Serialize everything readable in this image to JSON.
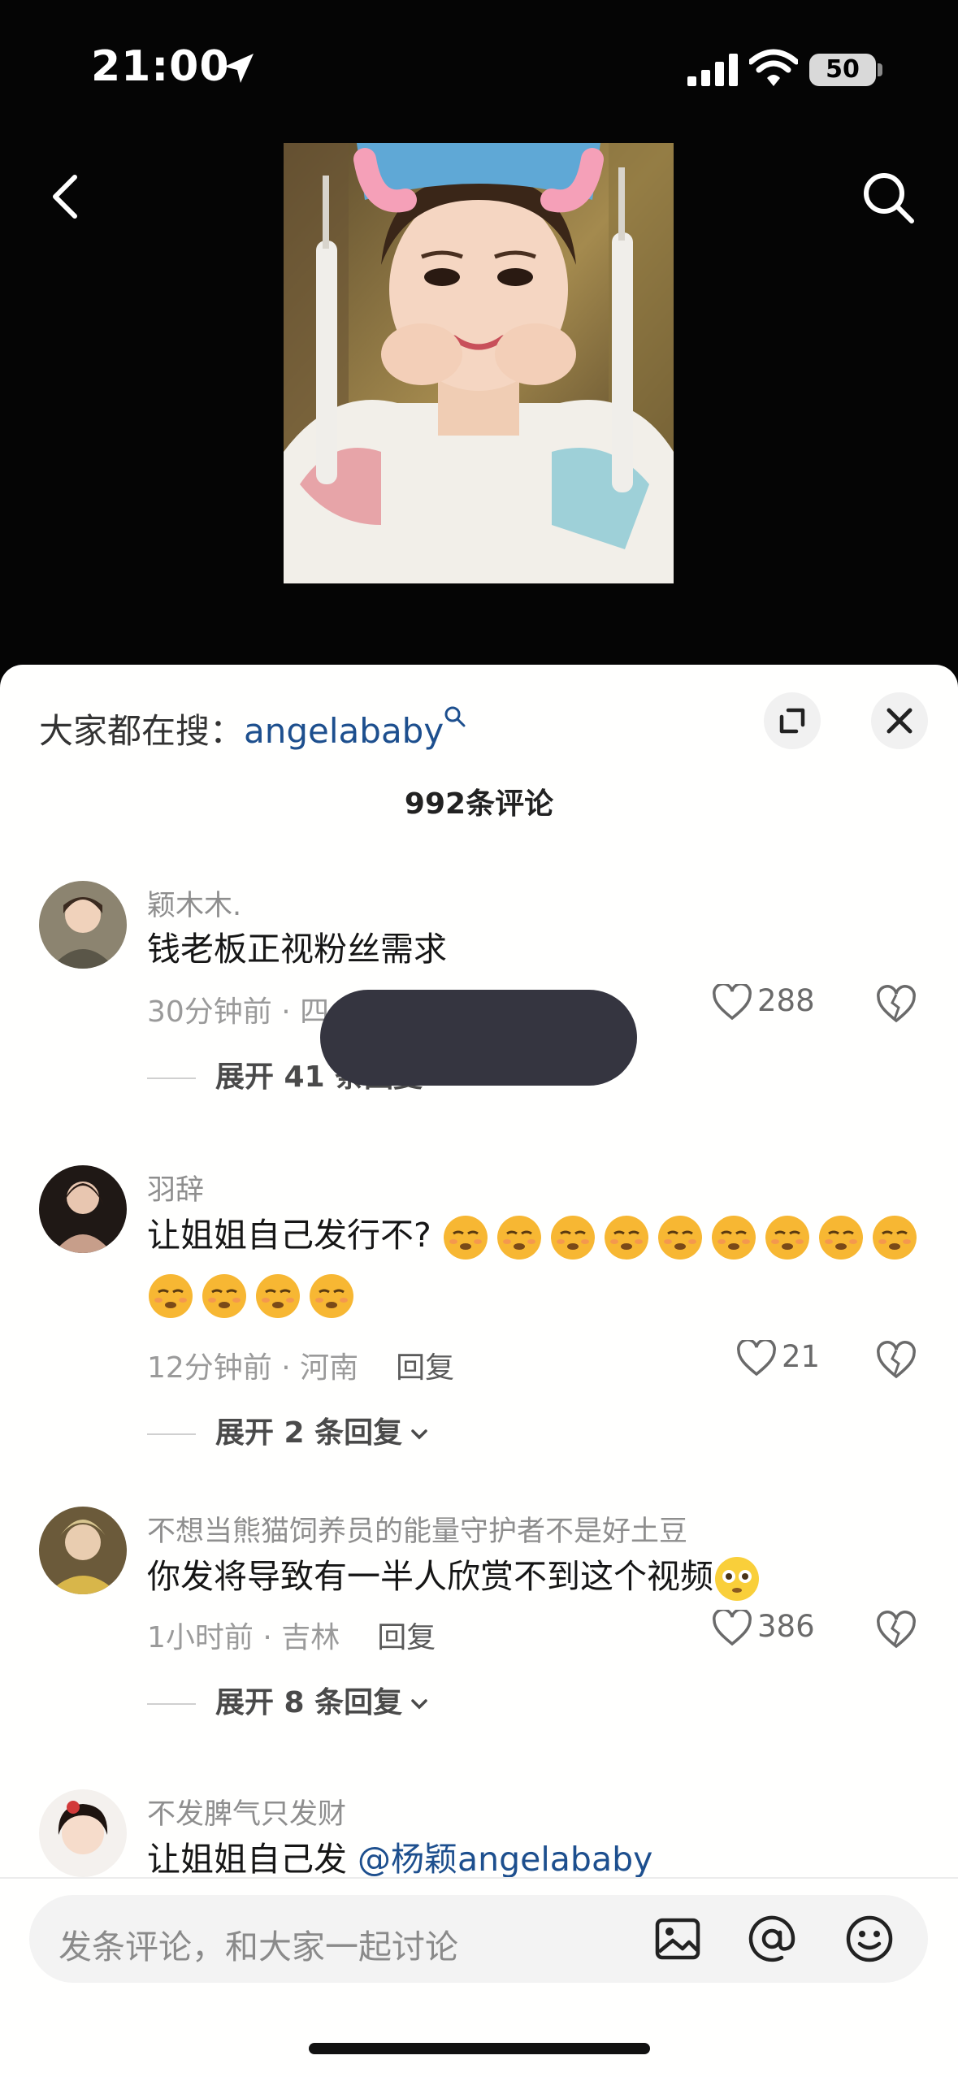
{
  "status_bar": {
    "time": "21:00",
    "battery": "50"
  },
  "header": {
    "back_icon": "chevron-left-icon",
    "search_icon": "search-icon"
  },
  "sheet": {
    "hot_search_prefix": "大家都在搜：",
    "hot_search_keyword": "angelababy",
    "comment_count_title": "992条评论"
  },
  "comments": [
    {
      "username": "颖木木.",
      "text": "钱老板正视粉丝需求",
      "time": "30分钟前 · 四",
      "reply_label": "",
      "likes": "288",
      "expand_label": "展开 41 条回复"
    },
    {
      "username": "羽辞",
      "text": "让姐姐自己发行不?",
      "time": "12分钟前 · 河南",
      "reply_label": "回复",
      "likes": "21",
      "expand_label": "展开 2 条回复"
    },
    {
      "username": "不想当熊猫饲养员的能量守护者不是好土豆",
      "text": "你发将导致有一半人欣赏不到这个视频",
      "time": "1小时前 · 吉林",
      "reply_label": "回复",
      "likes": "386",
      "expand_label": "展开 8 条回复"
    },
    {
      "username": "不发脾气只发财",
      "text": "让姐姐自己发",
      "mention": "@杨颖angelababy"
    }
  ],
  "composer": {
    "placeholder": "发条评论，和大家一起讨论"
  },
  "colors": {
    "link": "#1d4f8e",
    "sheet_bg": "#fffffe",
    "top_bg": "#050505"
  }
}
